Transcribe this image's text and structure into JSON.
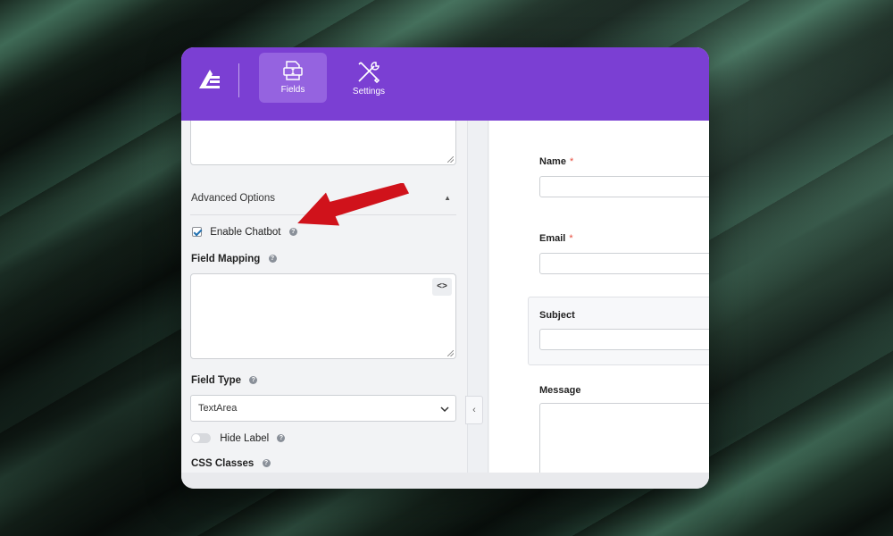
{
  "toolbar": {
    "items": [
      {
        "label": "Fields",
        "icon": "fields-icon",
        "active": true
      },
      {
        "label": "Settings",
        "icon": "settings-tools-icon",
        "active": false
      }
    ]
  },
  "left_panel": {
    "advanced_options": {
      "label": "Advanced Options",
      "caret": "▲"
    },
    "enable_chatbot": {
      "label": "Enable Chatbot",
      "checked": true
    },
    "field_mapping": {
      "label": "Field Mapping",
      "code_button": "<>"
    },
    "field_type": {
      "label": "Field Type",
      "value": "TextArea"
    },
    "hide_label": {
      "label": "Hide Label",
      "enabled": false
    },
    "css_classes": {
      "label": "CSS Classes"
    },
    "help_glyph": "?"
  },
  "form_preview": {
    "fields": [
      {
        "label": "Name",
        "required": true
      },
      {
        "label": "Email",
        "required": true
      },
      {
        "label": "Subject",
        "required": false
      },
      {
        "label": "Message",
        "required": false
      }
    ],
    "required_marker": "*"
  },
  "collapse_glyph": "‹",
  "colors": {
    "toolbar": "#7b3fd3",
    "toolbar_active": "#9563e0",
    "annotation_arrow": "#d0121b",
    "checkbox_check": "#2271b1",
    "required": "#e74c3c"
  }
}
